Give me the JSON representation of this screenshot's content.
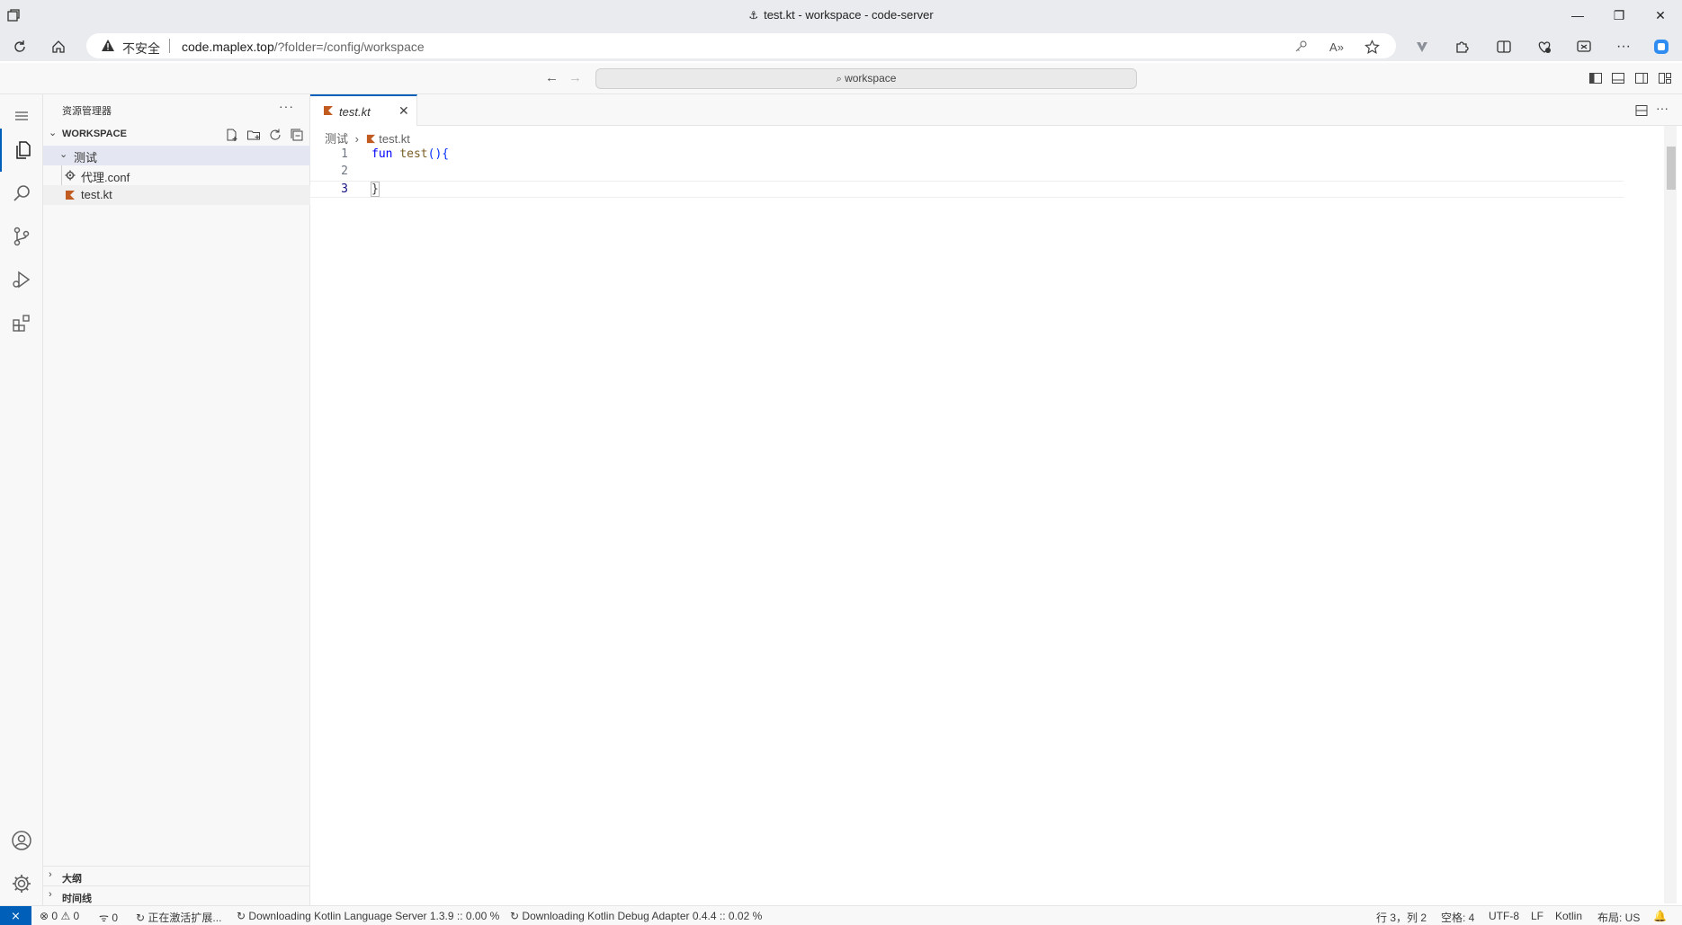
{
  "browser": {
    "window_title": "test.kt - workspace - code-server",
    "security_label": "不安全",
    "url_host": "code.maplex.top",
    "url_rest": "/?folder=/config/workspace"
  },
  "vscode": {
    "command_center": "workspace",
    "sidebar": {
      "title": "资源管理器",
      "more": "···",
      "workspace_label": "WORKSPACE",
      "tree": [
        {
          "label": "测试"
        },
        {
          "label": "代理.conf"
        },
        {
          "label": "test.kt"
        }
      ],
      "outline_label": "大纲",
      "timeline_label": "时间线"
    },
    "editor": {
      "tab_label": "test.kt",
      "breadcrumb_folder": "测试",
      "breadcrumb_file": "test.kt",
      "lines": [
        {
          "num": "1",
          "kw": "fun",
          "fn": "test",
          "punct": "(){"
        },
        {
          "num": "2",
          "text": ""
        },
        {
          "num": "3",
          "text": "}"
        }
      ]
    },
    "statusbar": {
      "errors": "0",
      "warnings": "0",
      "ports": "0",
      "activating": "正在激活扩展...",
      "task1": "Downloading Kotlin Language Server 1.3.9 :: 0.00 %",
      "task2": "Downloading Kotlin Debug Adapter 0.4.4 :: 0.02 %",
      "position": "行 3，列 2",
      "spaces": "空格: 4",
      "encoding": "UTF-8",
      "eol": "LF",
      "language": "Kotlin",
      "layout": "布局: US"
    }
  },
  "colors": {
    "accent": "#005fb8",
    "kotlin_icon": "#c15b1f"
  }
}
